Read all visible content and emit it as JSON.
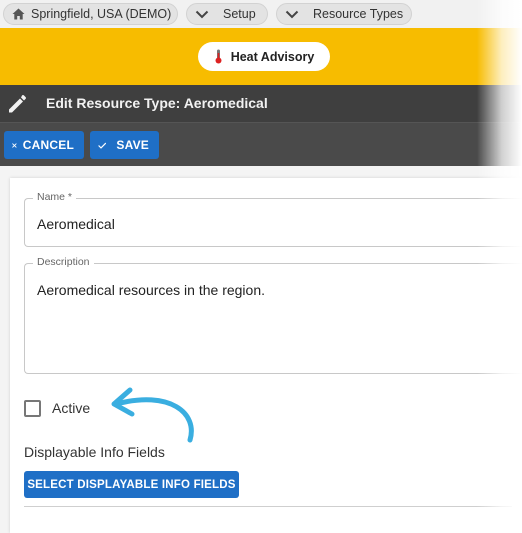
{
  "breadcrumbs": [
    {
      "label": "Springfield, USA (DEMO)",
      "icon": "home-icon"
    },
    {
      "label": "Setup",
      "icon": "chevron-down-icon"
    },
    {
      "label": "Resource Types",
      "icon": "chevron-down-icon"
    }
  ],
  "alert": {
    "label": "Heat Advisory",
    "icon": "thermometer-icon"
  },
  "title": {
    "text": "Edit Resource Type: Aeromedical",
    "icon": "pencil-icon"
  },
  "toolbar": {
    "cancel_label": "CANCEL",
    "save_label": "SAVE"
  },
  "form": {
    "name_label": "Name *",
    "name_value": "Aeromedical",
    "description_label": "Description",
    "description_value": "Aeromedical resources in the region.",
    "active_label": "Active",
    "active_checked": false,
    "info_fields_label": "Displayable Info Fields",
    "info_fields_button": "SELECT DISPLAYABLE INFO FIELDS"
  },
  "colors": {
    "accent_blue": "#1f6fc6",
    "alert_yellow": "#f7bc00",
    "titlebar": "#3f3f3f",
    "annotation_arrow": "#3aaee0"
  }
}
